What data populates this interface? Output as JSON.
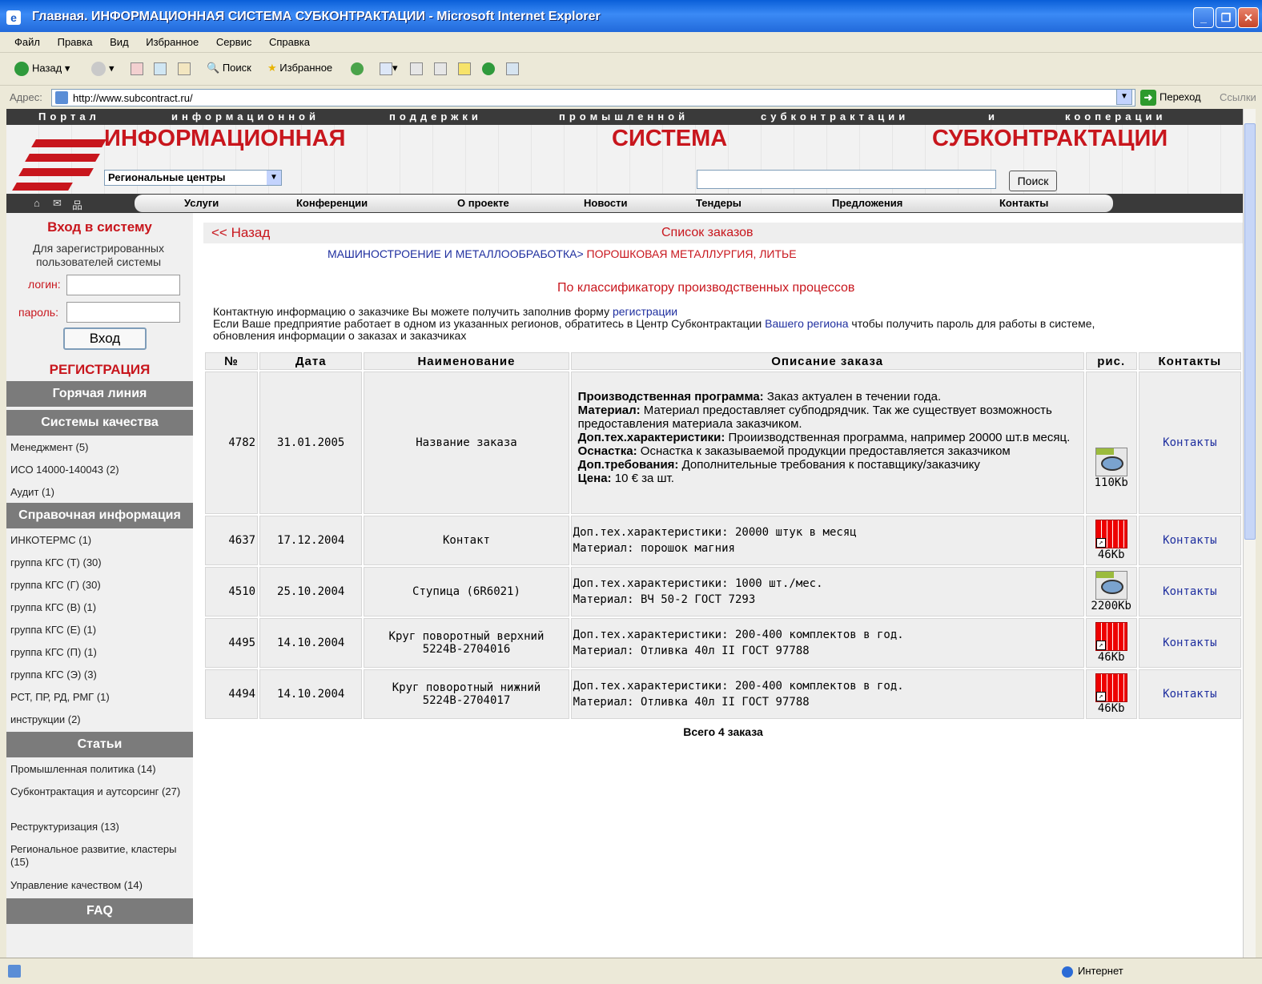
{
  "window": {
    "title": "Главная. ИНФОРМАЦИОННАЯ СИСТЕМА СУБКОНТРАКТАЦИИ - Microsoft Internet Explorer"
  },
  "menu": [
    "Файл",
    "Правка",
    "Вид",
    "Избранное",
    "Сервис",
    "Справка"
  ],
  "toolbar": {
    "back": "Назад",
    "search": "Поиск",
    "favorites": "Избранное"
  },
  "address": {
    "label": "Адрес:",
    "url": "http://www.subcontract.ru/",
    "go": "Переход",
    "links": "Ссылки"
  },
  "site": {
    "portal_words": [
      "Портал",
      "информационной",
      "поддержки",
      "промышленной",
      "субконтрактации",
      "и",
      "кооперации"
    ],
    "title_words": [
      "ИНФОРМАЦИОННАЯ",
      "СИСТЕМА",
      "СУБКОНТРАКТАЦИИ"
    ],
    "region_select": "Региональные центры",
    "search_button": "Поиск",
    "nav": [
      "Услуги",
      "Конференции",
      "О проекте",
      "Новости",
      "Тендеры",
      "Предложения",
      "Контакты"
    ]
  },
  "sidebar": {
    "login_title": "Вход в систему",
    "login_sub": "Для зарегистрированных пользователей системы",
    "login_label": "логин:",
    "password_label": "пароль:",
    "enter_button": "Вход",
    "register": "РЕГИСТРАЦИЯ",
    "hotline": "Горячая линия",
    "quality_head": "Системы качества",
    "quality_items": [
      "Менеджмент (5)",
      "ИСО 14000-140043 (2)",
      "Аудит (1)"
    ],
    "reference_head": "Справочная информация",
    "reference_items": [
      "ИНКОТЕРМС (1)",
      "группа КГС (Т) (30)",
      "группа КГС (Г) (30)",
      "группа КГС (В) (1)",
      "группа КГС (Е) (1)",
      "группа КГС (П) (1)",
      "группа КГС (Э) (3)",
      "РСТ, ПР, РД, РМГ (1)",
      "инструкции (2)"
    ],
    "articles_head": "Статьи",
    "article_items": [
      "Промышленная политика (14)",
      "Субконтрактация и аутсорсинг (27)",
      "Реструктуризация (13)",
      "Региональное развитие, кластеры (15)",
      "Управление качеством (14)"
    ],
    "faq": "FAQ"
  },
  "main": {
    "back": "<< Назад",
    "list_title": "Список заказов",
    "breadcrumb_a": "МАШИНОСТРОЕНИЕ И МЕТАЛЛООБРАБОТКА>",
    "breadcrumb_b": "ПОРОШКОВАЯ МЕТАЛЛУРГИЯ, ЛИТЬЕ",
    "classifier": "По классификатору производственных процессов",
    "info_line1_pre": "Контактную информацию о заказчике Вы можете получить заполнив форму ",
    "info_line1_link": "регистрации",
    "info_line2_pre": "Если Ваше предприятие работает в одном из указанных регионов, обратитесь в Центр Субконтрактации ",
    "info_line2_link": "Вашего региона",
    "info_line2_post": " чтобы получить пароль для работы в системе, обновления информации о заказах и заказчиках",
    "total": "Всего 4 заказа"
  },
  "table": {
    "headers": [
      "№",
      "Дата",
      "Наименование",
      "Описание заказа",
      "рис.",
      "Контакты"
    ],
    "first_row": {
      "num": "4782",
      "date": "31.01.2005",
      "name": "Название заказа",
      "desc": [
        {
          "k": "Производственная программа:",
          "v": " Заказ актуален в течении года."
        },
        {
          "k": "Материал:",
          "v": " Материал предоставляет субподрядчик. Так же существует возможность предоставления материала заказчиком."
        },
        {
          "k": "Доп.тех.характеристики:",
          "v": " Проиизводственная программа, например 20000 шт.в месяц."
        },
        {
          "k": "Оснастка:",
          "v": " Оснастка к заказываемой продукции предоставляется заказчиком"
        },
        {
          "k": "Доп.требования:",
          "v": " Дополнительные требования к поставщику/заказчику"
        },
        {
          "k": "Цена:",
          "v": " 10 € за шт."
        }
      ],
      "pic_type": "jpg-icon",
      "pic_size": "110Kb",
      "contact": "Контакты"
    },
    "rows": [
      {
        "num": "4637",
        "date": "17.12.2004",
        "name": "Контакт",
        "desc1": "Доп.тех.характеристики: 20000 штук в месяц",
        "desc2": "Материал: порошок магния",
        "pic_type": "drawing-icon",
        "pic_size": "46Kb",
        "contact": "Контакты"
      },
      {
        "num": "4510",
        "date": "25.10.2004",
        "name": "Ступица (6R6021)",
        "desc1": "Доп.тех.характеристики: 1000 шт./мес.",
        "desc2": "Материал: ВЧ 50-2 ГОСТ 7293",
        "pic_type": "jpg-icon",
        "pic_size": "2200Kb",
        "contact": "Контакты"
      },
      {
        "num": "4495",
        "date": "14.10.2004",
        "name": "Круг поворотный верхний 5224В-2704016",
        "desc1": "Доп.тех.характеристики: 200-400 комплектов в год.",
        "desc2": "Материал: Отливка 40л II ГОСТ 97788",
        "pic_type": "drawing-icon",
        "pic_size": "46Kb",
        "contact": "Контакты"
      },
      {
        "num": "4494",
        "date": "14.10.2004",
        "name": "Круг поворотный нижний 5224В-2704017",
        "desc1": "Доп.тех.характеристики: 200-400 комплектов в год.",
        "desc2": "Материал: Отливка 40л II ГОСТ 97788",
        "pic_type": "drawing-icon",
        "pic_size": "46Kb",
        "contact": "Контакты"
      }
    ]
  },
  "status": {
    "zone": "Интернет"
  },
  "colors": {
    "brand_red": "#c8161d",
    "link_blue": "#1f2f9f",
    "sidebar_head": "#7b7b7b",
    "xp_title": "#0a5fd8"
  }
}
